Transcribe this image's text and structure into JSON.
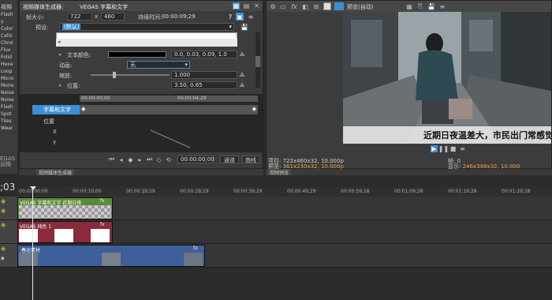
{
  "left_list": {
    "title": "视频",
    "items": [
      "Flash",
      "y",
      "Color",
      "Cells",
      "Chroi",
      "Flux",
      "Folid",
      "Hexa",
      "Loop",
      "Micro",
      "Moire",
      "Noise",
      "Noise",
      "Flash",
      "Spot",
      "Tiles",
      "Wear"
    ]
  },
  "media_gen": {
    "tab_title": "视频媒体生成器:",
    "header_text": "VEGAS 字幕和文字",
    "frame_size_label": "帧大小:",
    "frame_w": "722",
    "x_sep": "x",
    "frame_h": "460",
    "duration_label": "持续时间:",
    "duration": "00:00:09;29",
    "preset_label": "预设:",
    "preset_value": "(默认)",
    "text_color_label": "文本颜色:",
    "text_color_value": "0.0, 0.03, 0.09, 1.0",
    "animation_label": "动画:",
    "animation_value": "无",
    "scale_label": "缩放:",
    "scale_value": "1.000",
    "position_label": "位置:",
    "position_value": "3.50, 0.65",
    "timecode_start": "00:00:00;00",
    "timecode_mid": "00:00:04;29",
    "keyframe_track_label": "字幕和文字",
    "position_track": "位置",
    "x_track": "X",
    "y_track": "Y",
    "bottom_timecode": "00:00:00;00",
    "sync_label": "通道",
    "interp_label": "曲线",
    "bottom_tab": "视频媒体生成器"
  },
  "preview": {
    "toolbar_mode": "预览(自动)",
    "subtitle": "近期日夜温差大，市民出门常感觉在",
    "project_label": "项目:",
    "project_value": "722x460x32, 10.000p",
    "preview_label": "预览:",
    "preview_value": "361x230x32, 10.000p",
    "frame_label": "帧:",
    "frame_value": "0",
    "display_label": "显示:",
    "display_value": "246x348x32, 10.000",
    "bottom_tab": "视频预览"
  },
  "timeline": {
    "current_time": ";03",
    "ruler": [
      "00:00:00;00",
      "00:00:10;00",
      "00:00:19;29",
      "00:00:29;29",
      "00:00:39;29",
      "00:00:49;29",
      "00:00:59;28",
      "00:01:09;28",
      "00:01:19;28",
      "00:01:29;28"
    ],
    "track1_clip": "VEGAS 字幕和文字 近期日夜",
    "track2_clip": "VEGAS 纯色 1",
    "track3_clip": "春运素材"
  },
  "side_labels": [
    "V",
    "EGAS",
    "运输"
  ],
  "colors": {
    "accent": "#3a8fd6",
    "text_clip": "#5a8a3a",
    "solid_clip": "#8a2a3a",
    "video_clip": "#3e5f9a"
  }
}
